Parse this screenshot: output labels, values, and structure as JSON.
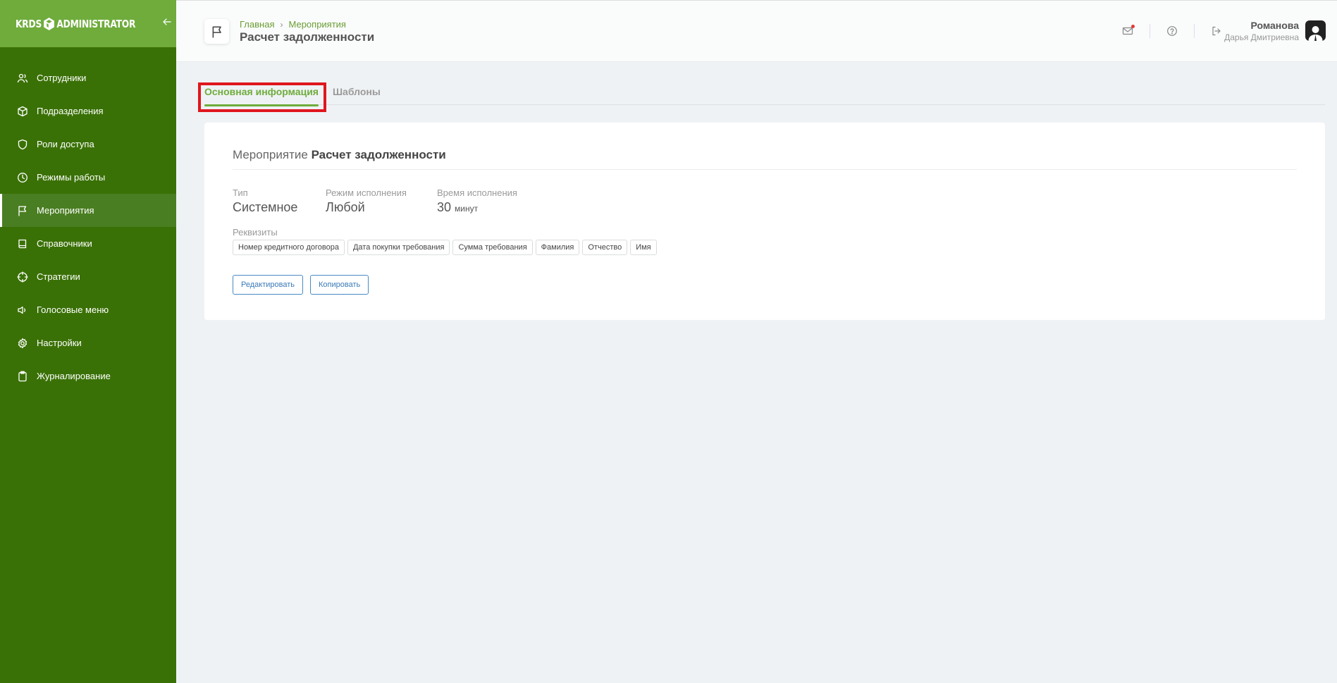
{
  "app": {
    "logo_left": "KRDS",
    "logo_right": "ADMINISTRATOR",
    "collapse_icon": "arrow-left-icon"
  },
  "sidebar": {
    "items": [
      {
        "label": "Сотрудники",
        "icon": "users-icon"
      },
      {
        "label": "Подразделения",
        "icon": "box-icon"
      },
      {
        "label": "Роли доступа",
        "icon": "shield-icon"
      },
      {
        "label": "Режимы работы",
        "icon": "clock-icon"
      },
      {
        "label": "Мероприятия",
        "icon": "flag-icon",
        "active": true
      },
      {
        "label": "Справочники",
        "icon": "book-icon"
      },
      {
        "label": "Стратегии",
        "icon": "crosshair-icon"
      },
      {
        "label": "Голосовые меню",
        "icon": "speaker-icon"
      },
      {
        "label": "Настройки",
        "icon": "gear-icon"
      },
      {
        "label": "Журналирование",
        "icon": "clipboard-icon"
      }
    ]
  },
  "header": {
    "breadcrumbs": [
      "Главная",
      "Мероприятия"
    ],
    "breadcrumb_separator": "›",
    "title": "Расчет задолженности",
    "user_last_name": "Романова",
    "user_first_name": "Дарья Дмитриевна"
  },
  "tabs": [
    {
      "label": "Основная информация",
      "active": true
    },
    {
      "label": "Шаблоны",
      "active": false
    }
  ],
  "card": {
    "title_prefix": "Мероприятие",
    "title_name": "Расчет задолженности",
    "type_label": "Тип",
    "type_value": "Системное",
    "mode_label": "Режим исполнения",
    "mode_value": "Любой",
    "time_label": "Время исполнения",
    "time_value": "30",
    "time_unit": "минут",
    "requisites_label": "Реквизиты",
    "requisites": [
      "Номер кредитного договора",
      "Дата покупки требования",
      "Сумма требования",
      "Фамилия",
      "Отчество",
      "Имя"
    ],
    "edit_button": "Редактировать",
    "copy_button": "Копировать"
  },
  "colors": {
    "sidebar_bg": "#3a7106",
    "sidebar_head": "#6fac3c",
    "accent": "#6fac3c",
    "highlight": "#e0161e",
    "button_blue": "#3a7ab8"
  }
}
